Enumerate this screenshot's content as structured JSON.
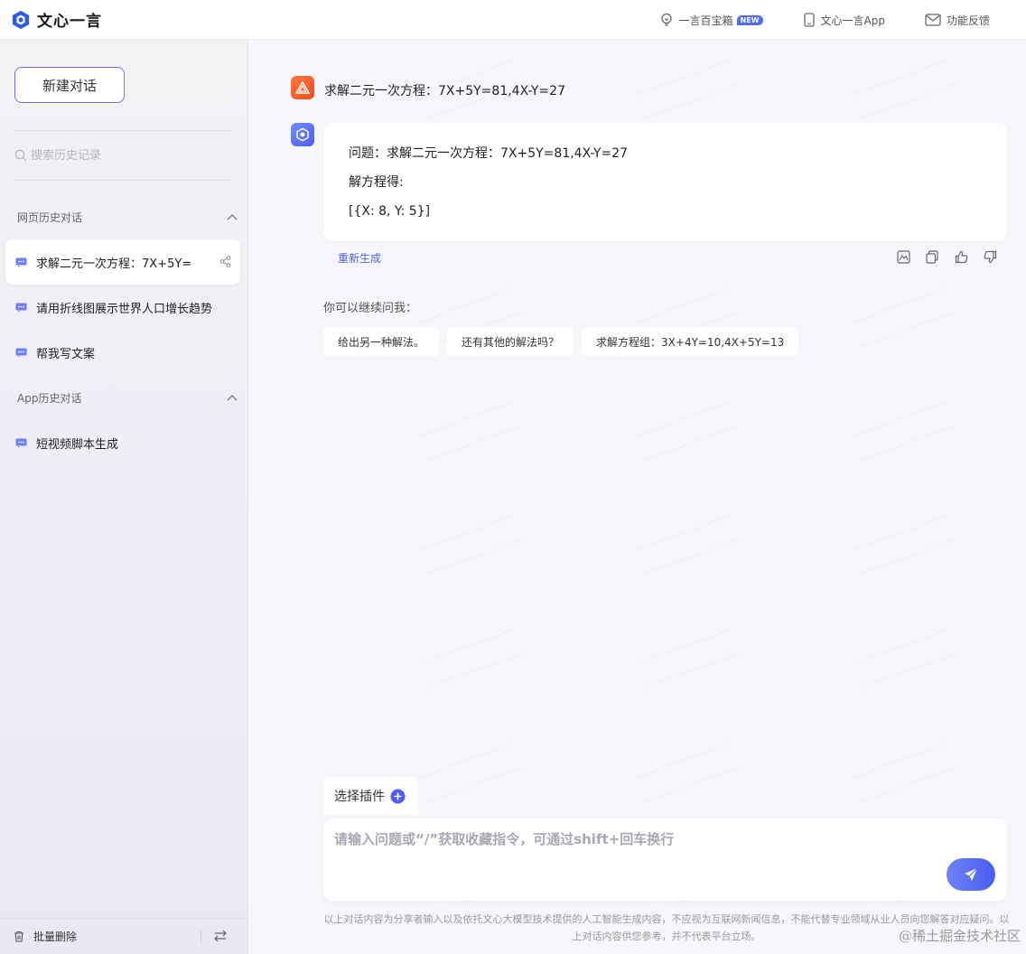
{
  "app": {
    "name": "文心一言"
  },
  "header": {
    "actions": [
      {
        "label": "一言百宝箱",
        "badge": "NEW",
        "icon": "lightbulb-icon"
      },
      {
        "label": "文心一言App",
        "icon": "phone-icon"
      },
      {
        "label": "功能反馈",
        "icon": "mail-icon"
      }
    ]
  },
  "sidebar": {
    "new_chat_label": "新建对话",
    "search_placeholder": "搜索历史记录",
    "groups": [
      {
        "title": "网页历史对话",
        "items": [
          {
            "label": "求解二元一次方程：7X+5Y=",
            "active": true
          },
          {
            "label": "请用折线图展示世界人口增长趋势",
            "active": false
          },
          {
            "label": "帮我写文案",
            "active": false
          }
        ]
      },
      {
        "title": "App历史对话",
        "items": [
          {
            "label": "短视频脚本生成",
            "active": false
          }
        ]
      }
    ],
    "footer": {
      "batch_delete_label": "批量删除"
    }
  },
  "conversation": {
    "user_message": "求解二元一次方程：7X+5Y=81,4X-Y=27",
    "bot_lines": [
      "问题：求解二元一次方程：7X+5Y=81,4X-Y=27",
      "解方程得:",
      "[{X: 8, Y: 5}]"
    ],
    "regenerate_label": "重新生成",
    "suggest_title": "你可以继续问我：",
    "suggestions": [
      "给出另一种解法。",
      "还有其他的解法吗？",
      "求解方程组：3X+4Y=10,4X+5Y=13"
    ]
  },
  "composer": {
    "plugin_label": "选择插件",
    "placeholder": "请输入问题或“/”获取收藏指令，可通过shift+回车换行",
    "value": ""
  },
  "disclaimer": "以上对话内容为分享者输入以及依托文心大模型技术提供的人工智能生成内容，不应视为互联网新闻信息，不能代替专业领域从业人员向您解答对应疑问。以上对话内容供您参考，并不代表平台立场。",
  "site_mark": "@稀土掘金技术社区",
  "colors": {
    "accent": "#4e5ef2",
    "user_avatar": "#f24b1f"
  }
}
